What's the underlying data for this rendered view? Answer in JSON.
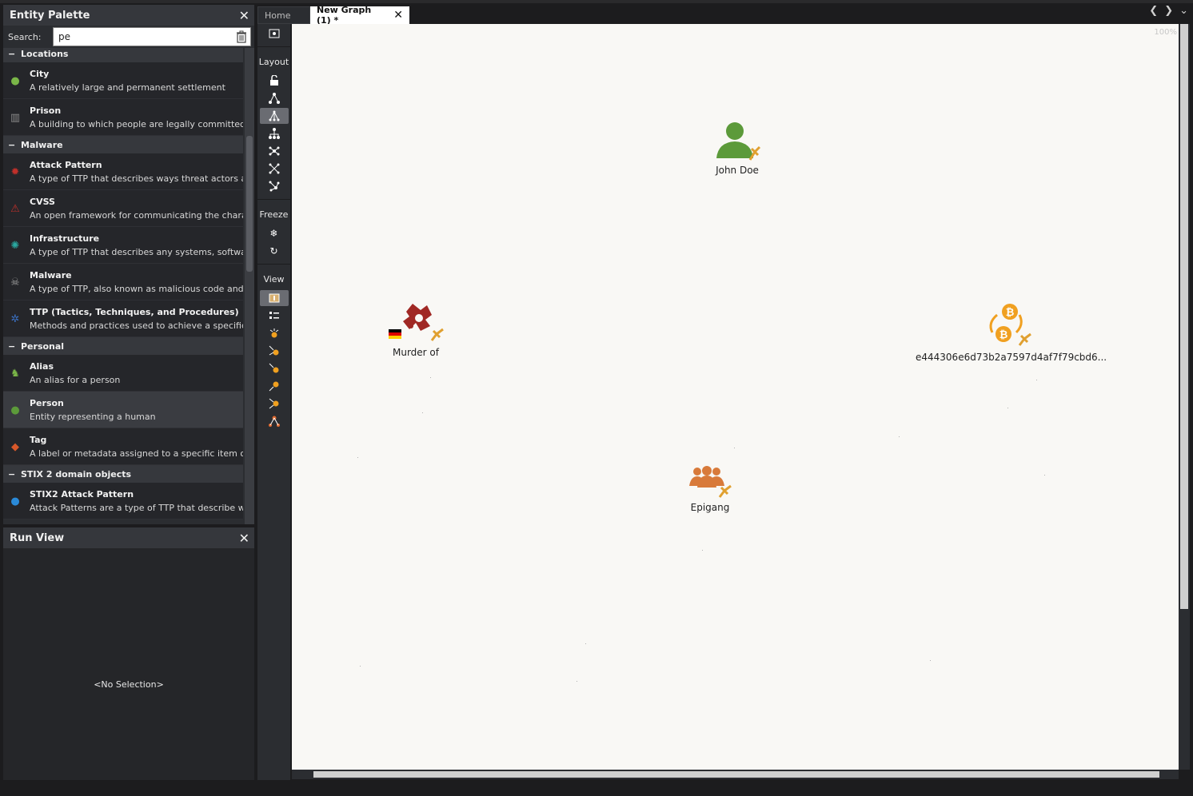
{
  "palette": {
    "title": "Entity Palette",
    "search_label": "Search:",
    "search_value": "pe",
    "categories": [
      {
        "name": "Locations",
        "items": [
          {
            "title": "City",
            "desc": "A relatively large and permanent settlement",
            "icon": "globe-icon",
            "color": "#7ab648"
          },
          {
            "title": "Prison",
            "desc": "A building to which people are legally committed as",
            "icon": "prison-bars-icon",
            "color": "#8a8a8a"
          }
        ]
      },
      {
        "name": "Malware",
        "items": [
          {
            "title": "Attack Pattern",
            "desc": "A type of TTP that describes ways threat actors atte",
            "icon": "attack-target-icon",
            "color": "#c0302a"
          },
          {
            "title": "CVSS",
            "desc": "An open framework for communicating the charact",
            "icon": "cvss-icon",
            "color": "#c0302a"
          },
          {
            "title": "Infrastructure",
            "desc": "A type of TTP that describes any systems, software s",
            "icon": "network-icon",
            "color": "#2aa8a0"
          },
          {
            "title": "Malware",
            "desc": "A type of TTP, also known as malicious code and ma",
            "icon": "skull-icon",
            "color": "#9a9a9a"
          },
          {
            "title": "TTP (Tactics, Techniques, and Procedures)",
            "desc": "Methods and practices used to achieve a specific ob",
            "icon": "gear-icon",
            "color": "#3a6fc0"
          }
        ]
      },
      {
        "name": "Personal",
        "items": [
          {
            "title": "Alias",
            "desc": "An alias for a person",
            "icon": "alias-person-icon",
            "color": "#7ab648"
          },
          {
            "title": "Person",
            "desc": "Entity representing a human",
            "icon": "person-icon",
            "color": "#5c9a3a"
          },
          {
            "title": "Tag",
            "desc": "A label or metadata assigned to a specific item or co",
            "icon": "tag-icon",
            "color": "#d8582a"
          }
        ]
      },
      {
        "name": "STIX 2 domain objects",
        "items": [
          {
            "title": "STIX2 Attack Pattern",
            "desc": "Attack Patterns are a type of TTP that describe ways",
            "icon": "stix-globe-icon",
            "color": "#2a8ad8"
          }
        ]
      }
    ]
  },
  "runview": {
    "title": "Run View",
    "empty": "<No Selection>"
  },
  "tabs": {
    "home": "Home",
    "active": "New Graph (1) *"
  },
  "toolbar": {
    "layout": "Layout",
    "freeze": "Freeze",
    "view": "View"
  },
  "canvas": {
    "zoom": "100%",
    "nodes": {
      "john": "John Doe",
      "murder": "Murder of",
      "bitcoin": "e444306e6d73b2a7597d4af7f79cbd6...",
      "epigang": "Epigang"
    }
  },
  "colors": {
    "person": "#5c9a3a",
    "crime": "#a02824",
    "bitcoin": "#f0a020",
    "group": "#d87a3a",
    "pin": "#e0a030"
  }
}
